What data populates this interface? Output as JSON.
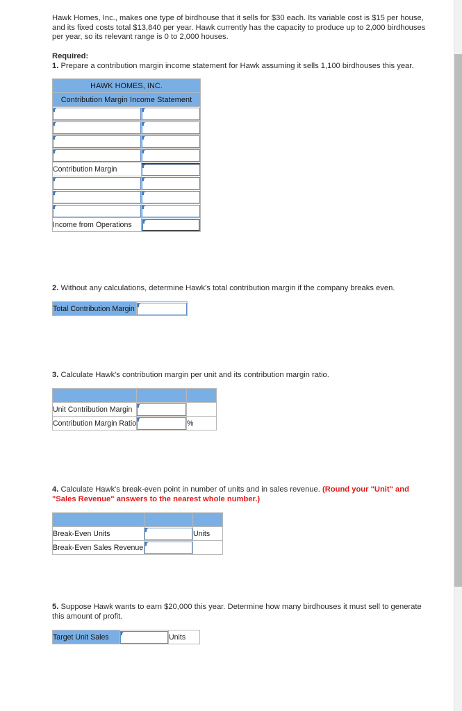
{
  "problem": {
    "intro": "Hawk Homes, Inc., makes one type of birdhouse that it sells for $30 each. Its variable cost is $15 per house, and its fixed costs total $13,840 per year. Hawk currently has the capacity to produce up to 2,000 birdhouses per year, so its relevant range is 0 to 2,000 houses.",
    "required_label": "Required:"
  },
  "q1": {
    "number": "1.",
    "text": "Prepare a contribution margin income statement for Hawk assuming it sells 1,100 birdhouses this year.",
    "table": {
      "company_title": "HAWK HOMES, INC.",
      "statement_title": "Contribution Margin Income Statement",
      "rows": [
        {
          "label": "",
          "label_input": true,
          "value_input": true,
          "rule": ""
        },
        {
          "label": "",
          "label_input": true,
          "value_input": true,
          "rule": ""
        },
        {
          "label": "",
          "label_input": true,
          "value_input": true,
          "rule": ""
        },
        {
          "label": "",
          "label_input": true,
          "value_input": true,
          "rule": ""
        },
        {
          "label": "Contribution Margin",
          "label_input": false,
          "value_input": true,
          "rule": "top"
        },
        {
          "label": "",
          "label_input": true,
          "value_input": true,
          "rule": ""
        },
        {
          "label": "",
          "label_input": true,
          "value_input": true,
          "rule": ""
        },
        {
          "label": "",
          "label_input": true,
          "value_input": true,
          "rule": ""
        },
        {
          "label": "Income from Operations",
          "label_input": false,
          "value_input": true,
          "rule": "total"
        }
      ]
    }
  },
  "q2": {
    "number": "2.",
    "text": "Without any calculations, determine Hawk's total contribution margin if the company breaks even.",
    "table": {
      "rows": [
        {
          "label": "Total Contribution Margin",
          "value_input": true
        }
      ]
    }
  },
  "q3": {
    "number": "3.",
    "text": "Calculate Hawk's contribution margin per unit and its contribution margin ratio.",
    "table": {
      "header": [
        "",
        "",
        ""
      ],
      "rows": [
        {
          "label": "Unit Contribution Margin",
          "value_input": true,
          "suffix": ""
        },
        {
          "label": "Contribution Margin Ratio",
          "value_input": true,
          "suffix": "%"
        }
      ]
    }
  },
  "q4": {
    "number": "4.",
    "text": "Calculate Hawk's break-even point in number of units and in sales revenue. ",
    "text_emphasis": "(Round your \"Unit\" and \"Sales Revenue\" answers to the nearest whole number.)",
    "table": {
      "header": [
        "",
        "",
        ""
      ],
      "rows": [
        {
          "label": "Break-Even Units",
          "value_input": true,
          "suffix": "Units"
        },
        {
          "label": "Break-Even Sales Revenue",
          "value_input": true,
          "suffix": ""
        }
      ]
    }
  },
  "q5": {
    "number": "5.",
    "text": "Suppose Hawk wants to earn $20,000 this year. Determine how many birdhouses it must sell to generate this amount of profit.",
    "table": {
      "rows": [
        {
          "label": "Target Unit Sales",
          "value_input": true,
          "suffix": "Units"
        }
      ]
    }
  },
  "colors": {
    "header_blue": "#7aafe5",
    "input_border": "#5b8fc9",
    "emphasis_red": "#e01a1a",
    "scrollbar_thumb": "#bcbcbc"
  }
}
